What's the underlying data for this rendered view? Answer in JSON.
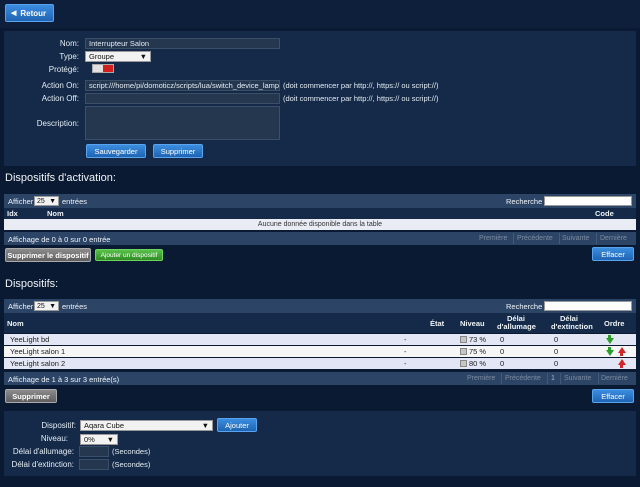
{
  "back_label": "Retour",
  "form": {
    "name_label": "Nom:",
    "name_value": "Interrupteur Salon",
    "type_label": "Type:",
    "type_value": "Groupe",
    "protected_label": "Protégé:",
    "action_on_label": "Action On:",
    "action_on_value": "script:///home/pi/domoticz/scripts/lua/switch_device_lamp_sa",
    "action_on_hint": "(doit commencer par http://, https:// ou script://)",
    "action_off_label": "Action Off:",
    "action_off_value": "",
    "action_off_hint": "(doit commencer par http://, https:// ou script://)",
    "description_label": "Description:",
    "save_label": "Sauvegarder",
    "delete_label": "Supprimer"
  },
  "activation": {
    "title": "Dispositifs d'activation:",
    "show_label": "Afficher",
    "show_value": "25",
    "entries_label": "entrées",
    "search_label": "Recherche :",
    "columns": [
      "Idx",
      "Nom",
      "Code"
    ],
    "empty_text": "Aucune donnée disponible dans la table",
    "info": "Affichage de 0 à 0 sur 0 entrée",
    "pager": [
      "Première",
      "Précédente",
      "Suivante",
      "Dernière"
    ],
    "delete_device_label": "Supprimer le dispositif",
    "add_device_label": "Ajouter un dispositif",
    "clear_label": "Effacer"
  },
  "devices": {
    "title": "Dispositifs:",
    "show_label": "Afficher",
    "show_value": "25",
    "entries_label": "entrées",
    "search_label": "Recherche :",
    "columns": {
      "name": "Nom",
      "state": "État",
      "level": "Niveau",
      "on_delay_1": "Délai",
      "on_delay_2": "d'allumage",
      "off_delay_1": "Délai",
      "off_delay_2": "d'extinction",
      "order": "Ordre"
    },
    "rows": [
      {
        "name": "YeeLight bd",
        "state": "-",
        "level": "73 %",
        "on_delay": "0",
        "off_delay": "0"
      },
      {
        "name": "YeeLight salon 1",
        "state": "-",
        "level": "75 %",
        "on_delay": "0",
        "off_delay": "0"
      },
      {
        "name": "YeeLight salon 2",
        "state": "-",
        "level": "80 %",
        "on_delay": "0",
        "off_delay": "0"
      }
    ],
    "info": "Affichage de 1 à 3 sur 3 entrée(s)",
    "pager": [
      "Première",
      "Précédente",
      "1",
      "Suivante",
      "Dernière"
    ],
    "delete_label": "Supprimer",
    "clear_label": "Effacer"
  },
  "add_form": {
    "device_label": "Dispositif:",
    "device_value": "Aqara Cube",
    "add_label": "Ajouter",
    "level_label": "Niveau:",
    "level_value": "0%",
    "on_delay_label": "Délai d'allumage:",
    "on_delay_unit": "(Secondes)",
    "off_delay_label": "Délai d'extinction:",
    "off_delay_unit": "(Secondes)"
  },
  "colors": {
    "background": "#0b1a33",
    "panel": "#142a48",
    "accent_blue": "#2a77cc",
    "toggle_red": "#d11e1e",
    "add_green": "#3fa133"
  }
}
